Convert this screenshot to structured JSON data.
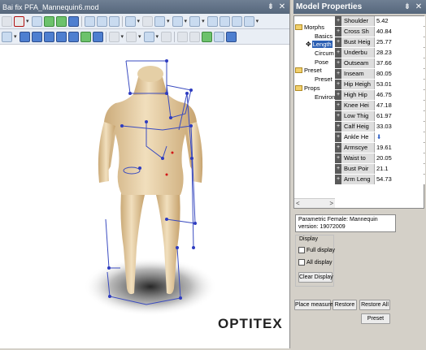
{
  "viewer": {
    "title": "Bai fix PFA_Mannequin6.mod",
    "title_buttons": [
      "pin-icon",
      "close-icon"
    ],
    "brand_logo": "OPTITEX"
  },
  "panel": {
    "title": "Model Properties",
    "tree": [
      {
        "label": "Morphs",
        "icon": "folder-icon",
        "level": 0
      },
      {
        "label": "Basics",
        "level": 1
      },
      {
        "label": "Length",
        "level": 1,
        "selected": true
      },
      {
        "label": "Circum",
        "level": 1
      },
      {
        "label": "Pose",
        "level": 1
      },
      {
        "label": "Preset",
        "icon": "folder-icon",
        "level": 0
      },
      {
        "label": "Preset",
        "level": 1
      },
      {
        "label": "Props",
        "icon": "folder-icon",
        "level": 0
      },
      {
        "label": "Environ",
        "level": 1
      }
    ],
    "properties": [
      {
        "name": "Shoulder",
        "value": "5.42"
      },
      {
        "name": "Cross Sh",
        "value": "40.84"
      },
      {
        "name": "Bust Heig",
        "value": "25.77"
      },
      {
        "name": "Underbu",
        "value": "28.23"
      },
      {
        "name": "Outseam",
        "value": "37.66"
      },
      {
        "name": "Inseam",
        "value": "80.05"
      },
      {
        "name": "Hip Heigh",
        "value": "53.01"
      },
      {
        "name": "High Hip",
        "value": "46.75"
      },
      {
        "name": "Knee Hei",
        "value": "47.18"
      },
      {
        "name": "Low Thig",
        "value": "61.97"
      },
      {
        "name": "Calf Heig",
        "value": "33.03"
      },
      {
        "name": "Ankle He",
        "value": "",
        "active": true
      },
      {
        "name": "Armscye",
        "value": "19.61"
      },
      {
        "name": "Waist to",
        "value": "20.05"
      },
      {
        "name": "Bust Poir",
        "value": "21.1"
      },
      {
        "name": "Arm Leng",
        "value": "54.73"
      }
    ],
    "info_line1": "Parametric Female: Mannequin",
    "info_line2": "version: 19072009",
    "display_legend": "Display",
    "full_display": "Full display",
    "all_display": "All display",
    "clear_display": "Clear Display",
    "place_measure": "Place measure",
    "restore": "Restore",
    "restore_all": "Restore All",
    "preset": "Preset"
  },
  "colors": {
    "titlebar": "#5f7086",
    "skin": "#e9d3ab",
    "measure_line": "#3a4bc0",
    "selection": "#2b5fb3"
  }
}
